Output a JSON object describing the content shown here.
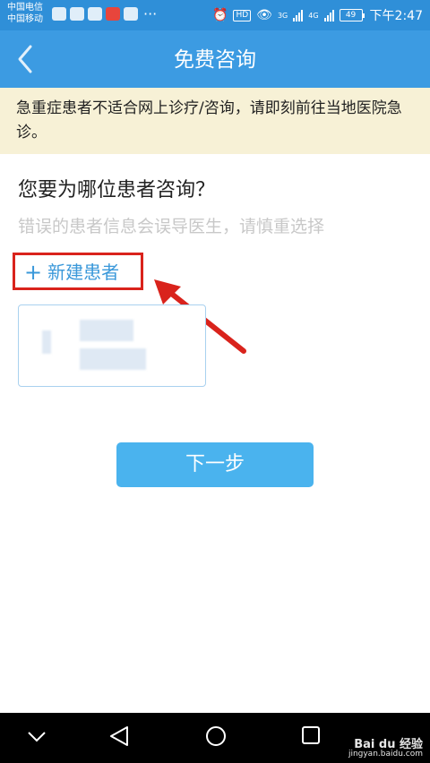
{
  "status_bar": {
    "carrier1": "中国电信",
    "carrier2": "中国移动",
    "more": "···",
    "hd": "HD",
    "net1": "3G",
    "net2": "4G",
    "battery": "49",
    "time": "下午2:47"
  },
  "header": {
    "title": "免费咨询",
    "back_icon": "chevron-left-icon"
  },
  "warning": {
    "text": "急重症患者不适合网上诊疗/咨询，请即刻前往当地医院急诊。"
  },
  "main": {
    "question": "您要为哪位患者咨询？",
    "hint": "错误的患者信息会误导医生，请慎重选择",
    "new_patient": {
      "plus": "+",
      "label": "新建患者"
    },
    "next_label": "下一步"
  },
  "watermark": {
    "brand": "Bai du 经验",
    "url": "jingyan.baidu.com"
  },
  "colors": {
    "header_bg": "#3c9be2",
    "status_bg": "#2f8fd8",
    "accent": "#3a98da",
    "button_bg": "#4ab3ee",
    "warning_bg": "#f7f1d6",
    "highlight_red": "#d9231c"
  }
}
